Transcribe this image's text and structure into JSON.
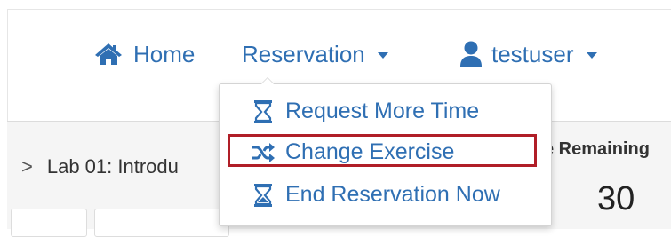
{
  "nav": {
    "home_label": "Home",
    "reservation_label": "Reservation",
    "user_label": "testuser"
  },
  "menu": {
    "items": [
      {
        "label": "Request More Time",
        "icon": "hourglass-icon"
      },
      {
        "label": "Change Exercise",
        "icon": "shuffle-icon",
        "highlighted": true
      },
      {
        "label": "End Reservation Now",
        "icon": "hourglass-end-icon"
      }
    ]
  },
  "content": {
    "lab_title": "Lab 01: Introdu",
    "time_remaining_label": "e Remaining",
    "timer_left": ")",
    "timer_right": "30"
  },
  "colors": {
    "link": "#2f6fb3",
    "highlight_border": "#b01e27",
    "content_bg": "#f5f5f5"
  }
}
